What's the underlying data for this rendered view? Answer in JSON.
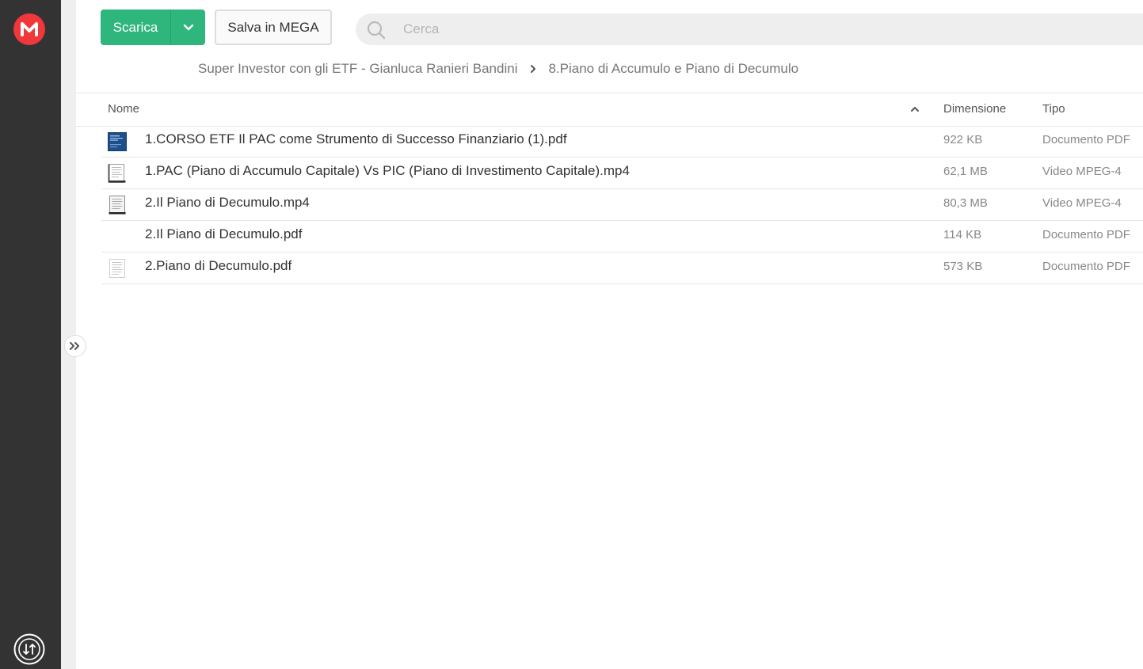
{
  "brand": {
    "logo_letter": "M",
    "color": "#f0373a"
  },
  "toolbar": {
    "download_label": "Scarica",
    "save_label": "Salva in MEGA",
    "accent_color": "#2eb67d"
  },
  "search": {
    "placeholder": "Cerca"
  },
  "breadcrumb": {
    "items": [
      {
        "label": "Super Investor con gli ETF - Gianluca Ranieri Bandini"
      },
      {
        "label": "8.Piano di Accumulo e Piano di Decumulo"
      }
    ]
  },
  "table": {
    "columns": {
      "name": "Nome",
      "size": "Dimensione",
      "type": "Tipo"
    },
    "sort": {
      "column": "name",
      "direction": "ascending"
    },
    "rows": [
      {
        "name": "1.CORSO ETF Il PAC come Strumento di Successo Finanziario (1).pdf",
        "size": "922 KB",
        "type": "Documento PDF",
        "thumb": "pdf-cover-thumbnail"
      },
      {
        "name": "1.PAC (Piano di Accumulo Capitale) Vs PIC (Piano di Investimento Capitale).mp4",
        "size": "62,1 MB",
        "type": "Video MPEG-4",
        "thumb": "document-thumbnail"
      },
      {
        "name": "2.Il Piano di Decumulo.mp4",
        "size": "80,3 MB",
        "type": "Video MPEG-4",
        "thumb": "document-thumbnail"
      },
      {
        "name": "2.Il Piano di Decumulo.pdf",
        "size": "114 KB",
        "type": "Documento PDF",
        "thumb": ""
      },
      {
        "name": "2.Piano di Decumulo.pdf",
        "size": "573 KB",
        "type": "Documento PDF",
        "thumb": "document-thumbnail"
      }
    ]
  }
}
